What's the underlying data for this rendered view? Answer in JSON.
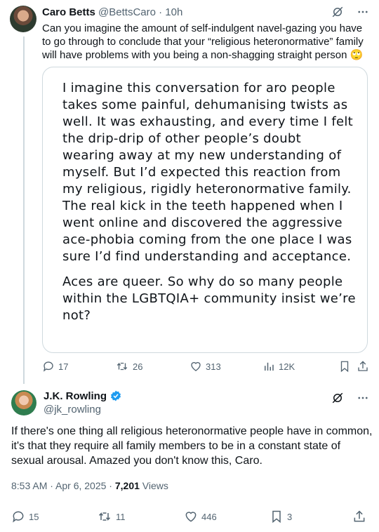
{
  "tweet1": {
    "author_name": "Caro Betts",
    "handle": "@BettsCaro",
    "separator": "·",
    "time": "10h",
    "text": "Can you imagine the amount of self-indulgent navel-gazing you have to go through to conclude that your “religious heteronormative” family will have problems with you being a non-shagging straight person 🙄",
    "quote_paragraphs": [
      "I imagine this conversation for aro people takes some painful, dehumanising twists as well. It was exhausting, and every time I felt the drip-drip of other people’s doubt wearing away at my new understanding of myself. But I’d expected this reaction from my religious, rigidly heteronormative family. The real kick in the teeth happened when I went online and discovered the aggressive ace-phobia coming from the one place I was sure I’d find understanding and acceptance.",
      "Aces are queer. So why do so many people within the LGBTQIA+ community insist we’re not?"
    ],
    "actions": {
      "replies": "17",
      "reposts": "26",
      "likes": "313",
      "views": "12K"
    }
  },
  "tweet2": {
    "author_name": "J.K. Rowling",
    "handle": "@jk_rowling",
    "text": "If there's one thing all religious heteronormative people have in common, it's that they require all family members to be in a constant state of sexual arousal. Amazed you don't know this, Caro.",
    "timestamp": "8:53 AM · Apr 6, 2025 · ",
    "views_count": "7,201",
    "views_label": " Views",
    "actions": {
      "replies": "15",
      "reposts": "11",
      "likes": "446",
      "bookmarks": "3"
    }
  },
  "colors": {
    "text": "#0f1419",
    "secondary": "#536471",
    "border": "#cfd9de",
    "verified": "#1d9bf0"
  }
}
